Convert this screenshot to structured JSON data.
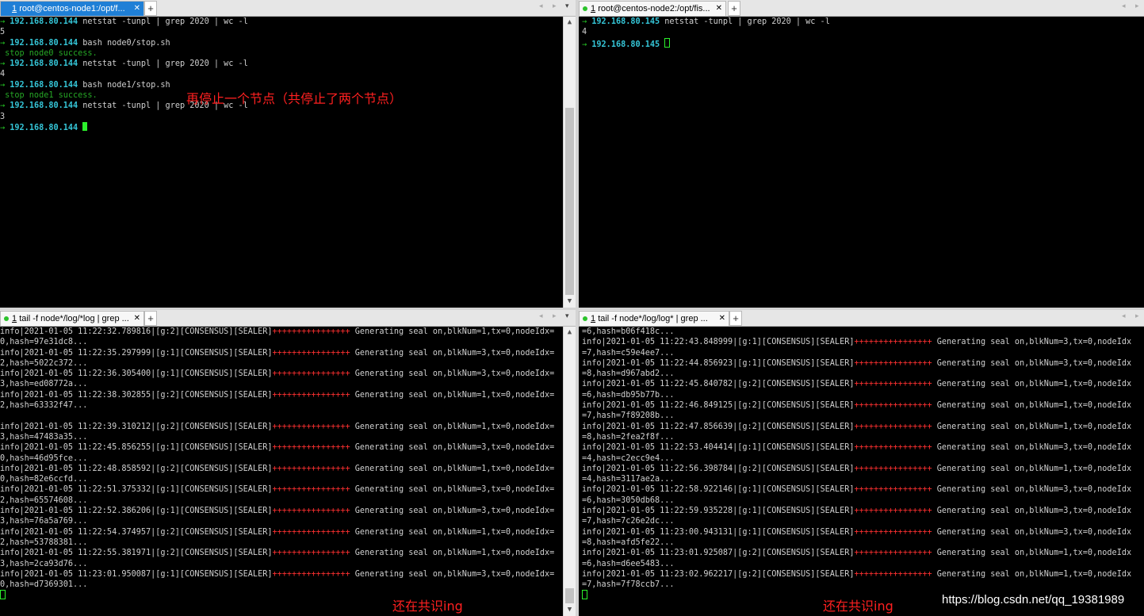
{
  "panes": {
    "tl": {
      "tab": {
        "num": "1",
        "title": "root@centos-node1:/opt/f...",
        "close": "✕"
      },
      "lines": [
        {
          "parts": [
            {
              "t": "→ ",
              "c": "arrow"
            },
            {
              "t": "192.168.80.144",
              "c": "ip"
            },
            {
              "t": " netstat -tunpl | grep 2020 | wc -l"
            }
          ]
        },
        {
          "parts": [
            {
              "t": "5"
            }
          ]
        },
        {
          "parts": [
            {
              "t": "→ ",
              "c": "arrow"
            },
            {
              "t": "192.168.80.144",
              "c": "ip"
            },
            {
              "t": " bash node0/stop.sh"
            }
          ]
        },
        {
          "parts": [
            {
              "t": " stop node0 success.",
              "c": "green"
            }
          ]
        },
        {
          "parts": [
            {
              "t": "→ ",
              "c": "arrow"
            },
            {
              "t": "192.168.80.144",
              "c": "ip"
            },
            {
              "t": " netstat -tunpl | grep 2020 | wc -l"
            }
          ]
        },
        {
          "parts": [
            {
              "t": "4"
            }
          ]
        },
        {
          "parts": [
            {
              "t": "→ ",
              "c": "arrow"
            },
            {
              "t": "192.168.80.144",
              "c": "ip"
            },
            {
              "t": " bash node1/stop.sh"
            }
          ]
        },
        {
          "parts": [
            {
              "t": " stop node1 success.",
              "c": "green"
            }
          ]
        },
        {
          "parts": [
            {
              "t": "→ ",
              "c": "arrow"
            },
            {
              "t": "192.168.80.144",
              "c": "ip"
            },
            {
              "t": " netstat -tunpl | grep 2020 | wc -l"
            }
          ]
        },
        {
          "parts": [
            {
              "t": "3"
            }
          ]
        },
        {
          "parts": [
            {
              "t": "→ ",
              "c": "arrow"
            },
            {
              "t": "192.168.80.144",
              "c": "ip"
            },
            {
              "t": " "
            },
            {
              "t": "",
              "c": "cursor"
            }
          ]
        }
      ]
    },
    "tr": {
      "tab": {
        "num": "1",
        "title": "root@centos-node2:/opt/fis...",
        "close": "✕"
      },
      "lines": [
        {
          "parts": [
            {
              "t": "→ ",
              "c": "arrow"
            },
            {
              "t": "192.168.80.145",
              "c": "ip"
            },
            {
              "t": " netstat -tunpl | grep 2020 | wc -l"
            }
          ]
        },
        {
          "parts": [
            {
              "t": "4"
            }
          ]
        },
        {
          "parts": [
            {
              "t": "→ ",
              "c": "arrow"
            },
            {
              "t": "192.168.80.145",
              "c": "ip"
            },
            {
              "t": " "
            },
            {
              "t": "",
              "c": "cursor-o"
            }
          ]
        }
      ]
    },
    "bl": {
      "tab": {
        "num": "1",
        "title": "tail -f node*/log/*log | grep ...",
        "close": "✕"
      },
      "lines": [
        {
          "parts": [
            {
              "t": "info|2021-01-05 11:22:32.789816|[g:2][CONSENSUS][SEALER]"
            },
            {
              "t": "++++++++++++++++",
              "c": "plusred"
            },
            {
              "t": " Generating seal on,blkNum=1,tx=0,nodeIdx="
            }
          ]
        },
        {
          "parts": [
            {
              "t": "0,hash=97e31dc8..."
            }
          ]
        },
        {
          "parts": [
            {
              "t": "info|2021-01-05 11:22:35.297999|[g:1][CONSENSUS][SEALER]"
            },
            {
              "t": "++++++++++++++++",
              "c": "plusred"
            },
            {
              "t": " Generating seal on,blkNum=3,tx=0,nodeIdx="
            }
          ]
        },
        {
          "parts": [
            {
              "t": "2,hash=5022c372..."
            }
          ]
        },
        {
          "parts": [
            {
              "t": "info|2021-01-05 11:22:36.305400|[g:1][CONSENSUS][SEALER]"
            },
            {
              "t": "++++++++++++++++",
              "c": "plusred"
            },
            {
              "t": " Generating seal on,blkNum=3,tx=0,nodeIdx="
            }
          ]
        },
        {
          "parts": [
            {
              "t": "3,hash=ed08772a..."
            }
          ]
        },
        {
          "parts": [
            {
              "t": "info|2021-01-05 11:22:38.302855|[g:2][CONSENSUS][SEALER]"
            },
            {
              "t": "++++++++++++++++",
              "c": "plusred"
            },
            {
              "t": " Generating seal on,blkNum=1,tx=0,nodeIdx="
            }
          ]
        },
        {
          "parts": [
            {
              "t": "2,hash=63332f47..."
            }
          ]
        },
        {
          "parts": [
            {
              "t": ""
            }
          ]
        },
        {
          "parts": [
            {
              "t": "info|2021-01-05 11:22:39.310212|[g:2][CONSENSUS][SEALER]"
            },
            {
              "t": "++++++++++++++++",
              "c": "plusred"
            },
            {
              "t": " Generating seal on,blkNum=1,tx=0,nodeIdx="
            }
          ]
        },
        {
          "parts": [
            {
              "t": "3,hash=47483a35..."
            }
          ]
        },
        {
          "parts": [
            {
              "t": "info|2021-01-05 11:22:45.856255|[g:1][CONSENSUS][SEALER]"
            },
            {
              "t": "++++++++++++++++",
              "c": "plusred"
            },
            {
              "t": " Generating seal on,blkNum=3,tx=0,nodeIdx="
            }
          ]
        },
        {
          "parts": [
            {
              "t": "0,hash=46d95fce..."
            }
          ]
        },
        {
          "parts": [
            {
              "t": "info|2021-01-05 11:22:48.858592|[g:2][CONSENSUS][SEALER]"
            },
            {
              "t": "++++++++++++++++",
              "c": "plusred"
            },
            {
              "t": " Generating seal on,blkNum=1,tx=0,nodeIdx="
            }
          ]
        },
        {
          "parts": [
            {
              "t": "0,hash=82e6ccfd..."
            }
          ]
        },
        {
          "parts": [
            {
              "t": "info|2021-01-05 11:22:51.375332|[g:1][CONSENSUS][SEALER]"
            },
            {
              "t": "++++++++++++++++",
              "c": "plusred"
            },
            {
              "t": " Generating seal on,blkNum=3,tx=0,nodeIdx="
            }
          ]
        },
        {
          "parts": [
            {
              "t": "2,hash=65574608..."
            }
          ]
        },
        {
          "parts": [
            {
              "t": "info|2021-01-05 11:22:52.386206|[g:1][CONSENSUS][SEALER]"
            },
            {
              "t": "++++++++++++++++",
              "c": "plusred"
            },
            {
              "t": " Generating seal on,blkNum=3,tx=0,nodeIdx="
            }
          ]
        },
        {
          "parts": [
            {
              "t": "3,hash=76a5a769..."
            }
          ]
        },
        {
          "parts": [
            {
              "t": "info|2021-01-05 11:22:54.374957|[g:2][CONSENSUS][SEALER]"
            },
            {
              "t": "++++++++++++++++",
              "c": "plusred"
            },
            {
              "t": " Generating seal on,blkNum=1,tx=0,nodeIdx="
            }
          ]
        },
        {
          "parts": [
            {
              "t": "2,hash=53788381..."
            }
          ]
        },
        {
          "parts": [
            {
              "t": "info|2021-01-05 11:22:55.381971|[g:2][CONSENSUS][SEALER]"
            },
            {
              "t": "++++++++++++++++",
              "c": "plusred"
            },
            {
              "t": " Generating seal on,blkNum=1,tx=0,nodeIdx="
            }
          ]
        },
        {
          "parts": [
            {
              "t": "3,hash=2ca93d76..."
            }
          ]
        },
        {
          "parts": [
            {
              "t": "info|2021-01-05 11:23:01.950087|[g:1][CONSENSUS][SEALER]"
            },
            {
              "t": "++++++++++++++++",
              "c": "plusred"
            },
            {
              "t": " Generating seal on,blkNum=3,tx=0,nodeIdx="
            }
          ]
        },
        {
          "parts": [
            {
              "t": "0,hash=d7369301..."
            }
          ]
        },
        {
          "parts": [
            {
              "t": "",
              "c": "cursor-o"
            }
          ]
        }
      ]
    },
    "br": {
      "tab": {
        "num": "1",
        "title": "tail -f node*/log/log* | grep ...",
        "close": "✕"
      },
      "lines": [
        {
          "parts": [
            {
              "t": "=6,hash=b06f418c..."
            }
          ]
        },
        {
          "parts": [
            {
              "t": "info|2021-01-05 11:22:43.848999|[g:1][CONSENSUS][SEALER]"
            },
            {
              "t": "++++++++++++++++",
              "c": "plusred"
            },
            {
              "t": " Generating seal on,blkNum=3,tx=0,nodeIdx"
            }
          ]
        },
        {
          "parts": [
            {
              "t": "=7,hash=c59e4ee7..."
            }
          ]
        },
        {
          "parts": [
            {
              "t": "info|2021-01-05 11:22:44.856923|[g:1][CONSENSUS][SEALER]"
            },
            {
              "t": "++++++++++++++++",
              "c": "plusred"
            },
            {
              "t": " Generating seal on,blkNum=3,tx=0,nodeIdx"
            }
          ]
        },
        {
          "parts": [
            {
              "t": "=8,hash=d967abd2..."
            }
          ]
        },
        {
          "parts": [
            {
              "t": "info|2021-01-05 11:22:45.840782|[g:2][CONSENSUS][SEALER]"
            },
            {
              "t": "++++++++++++++++",
              "c": "plusred"
            },
            {
              "t": " Generating seal on,blkNum=1,tx=0,nodeIdx"
            }
          ]
        },
        {
          "parts": [
            {
              "t": "=6,hash=db95b77b..."
            }
          ]
        },
        {
          "parts": [
            {
              "t": "info|2021-01-05 11:22:46.849125|[g:2][CONSENSUS][SEALER]"
            },
            {
              "t": "++++++++++++++++",
              "c": "plusred"
            },
            {
              "t": " Generating seal on,blkNum=1,tx=0,nodeIdx"
            }
          ]
        },
        {
          "parts": [
            {
              "t": "=7,hash=7f89208b..."
            }
          ]
        },
        {
          "parts": [
            {
              "t": "info|2021-01-05 11:22:47.856639|[g:2][CONSENSUS][SEALER]"
            },
            {
              "t": "++++++++++++++++",
              "c": "plusred"
            },
            {
              "t": " Generating seal on,blkNum=1,tx=0,nodeIdx"
            }
          ]
        },
        {
          "parts": [
            {
              "t": "=8,hash=2fea2f8f..."
            }
          ]
        },
        {
          "parts": [
            {
              "t": "info|2021-01-05 11:22:53.404414|[g:1][CONSENSUS][SEALER]"
            },
            {
              "t": "++++++++++++++++",
              "c": "plusred"
            },
            {
              "t": " Generating seal on,blkNum=3,tx=0,nodeIdx"
            }
          ]
        },
        {
          "parts": [
            {
              "t": "=4,hash=c2ecc9e4..."
            }
          ]
        },
        {
          "parts": [
            {
              "t": "info|2021-01-05 11:22:56.398784|[g:2][CONSENSUS][SEALER]"
            },
            {
              "t": "++++++++++++++++",
              "c": "plusred"
            },
            {
              "t": " Generating seal on,blkNum=1,tx=0,nodeIdx"
            }
          ]
        },
        {
          "parts": [
            {
              "t": "=4,hash=3117ae2a..."
            }
          ]
        },
        {
          "parts": [
            {
              "t": "info|2021-01-05 11:22:58.922146|[g:1][CONSENSUS][SEALER]"
            },
            {
              "t": "++++++++++++++++",
              "c": "plusred"
            },
            {
              "t": " Generating seal on,blkNum=3,tx=0,nodeIdx"
            }
          ]
        },
        {
          "parts": [
            {
              "t": "=6,hash=3050db68..."
            }
          ]
        },
        {
          "parts": [
            {
              "t": "info|2021-01-05 11:22:59.935228|[g:1][CONSENSUS][SEALER]"
            },
            {
              "t": "++++++++++++++++",
              "c": "plusred"
            },
            {
              "t": " Generating seal on,blkNum=3,tx=0,nodeIdx"
            }
          ]
        },
        {
          "parts": [
            {
              "t": "=7,hash=7c26e2dc..."
            }
          ]
        },
        {
          "parts": [
            {
              "t": "info|2021-01-05 11:23:00.943131|[g:1][CONSENSUS][SEALER]"
            },
            {
              "t": "++++++++++++++++",
              "c": "plusred"
            },
            {
              "t": " Generating seal on,blkNum=3,tx=0,nodeIdx"
            }
          ]
        },
        {
          "parts": [
            {
              "t": "=8,hash=afd5fe22..."
            }
          ]
        },
        {
          "parts": [
            {
              "t": "info|2021-01-05 11:23:01.925087|[g:2][CONSENSUS][SEALER]"
            },
            {
              "t": "++++++++++++++++",
              "c": "plusred"
            },
            {
              "t": " Generating seal on,blkNum=1,tx=0,nodeIdx"
            }
          ]
        },
        {
          "parts": [
            {
              "t": "=6,hash=d6ee5483..."
            }
          ]
        },
        {
          "parts": [
            {
              "t": "info|2021-01-05 11:23:02.962217|[g:2][CONSENSUS][SEALER]"
            },
            {
              "t": "++++++++++++++++",
              "c": "plusred"
            },
            {
              "t": " Generating seal on,blkNum=1,tx=0,nodeIdx"
            }
          ]
        },
        {
          "parts": [
            {
              "t": "=7,hash=7f78ccb7..."
            }
          ]
        },
        {
          "parts": [
            {
              "t": "",
              "c": "cursor-o"
            }
          ]
        }
      ]
    }
  },
  "annotations": {
    "stop_note": "再停止一个节点（共停止了两个节点）",
    "consensus_left": "还在共识ing",
    "consensus_right": "还在共识ing"
  },
  "watermark": "https://blog.csdn.net/qq_19381989",
  "icons": {
    "plus": "+",
    "nav": "◂ ▸",
    "dropdown": "▾",
    "scroll_up": "▲",
    "scroll_down": "▼"
  },
  "colors": {
    "tab_active": "#1f7fd6",
    "prompt_arrow": "#26d226",
    "prompt_ip": "#35c6d8",
    "seal_plus": "#ff3030",
    "annotation": "#ff2020"
  }
}
